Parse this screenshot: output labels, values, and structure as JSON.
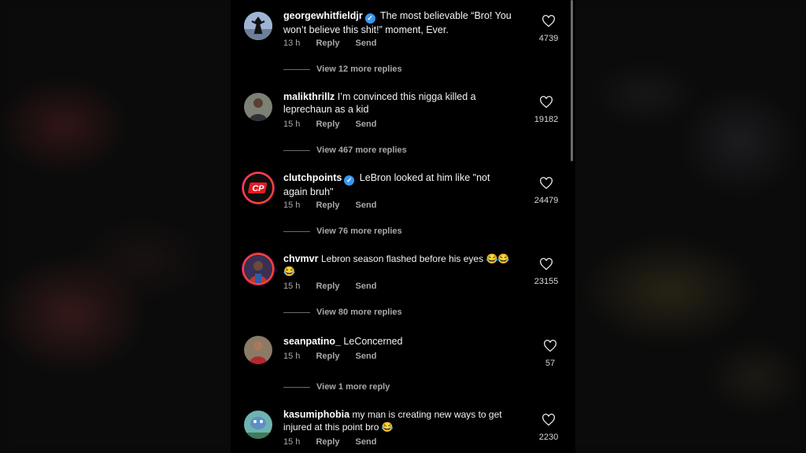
{
  "comments": [
    {
      "username": "georgewhitfieldjr",
      "verified": true,
      "text": "The most believable “Bro! You won’t believe this shit!” moment, Ever.",
      "time": "13 h",
      "reply_label": "Reply",
      "send_label": "Send",
      "likes": "4739",
      "replies": "View 12 more replies"
    },
    {
      "username": "malikthrillz",
      "verified": false,
      "text": "I’m convinced this nigga killed a leprechaun as a kid",
      "time": "15 h",
      "reply_label": "Reply",
      "send_label": "Send",
      "likes": "19182",
      "replies": "View 467 more replies"
    },
    {
      "username": "clutchpoints",
      "verified": true,
      "text": "LeBron looked at him like \"not again bruh\"",
      "time": "15 h",
      "reply_label": "Reply",
      "send_label": "Send",
      "likes": "24479",
      "replies": "View 76 more replies",
      "avatar_text": "CP"
    },
    {
      "username": "chvmvr",
      "verified": false,
      "text": "Lebron season flashed before his eyes 😂😂😂",
      "time": "15 h",
      "reply_label": "Reply",
      "send_label": "Send",
      "likes": "23155",
      "replies": "View 80 more replies"
    },
    {
      "username": "seanpatino_",
      "verified": false,
      "text": "LeConcerned",
      "time": "15 h",
      "reply_label": "Reply",
      "send_label": "Send",
      "likes": "57",
      "replies": "View 1 more reply"
    },
    {
      "username": "kasumiphobia",
      "verified": false,
      "text": "my man is creating new ways to get injured at this point bro 😂",
      "time": "15 h",
      "reply_label": "Reply",
      "send_label": "Send",
      "likes": "2230"
    }
  ],
  "colors": {
    "verified": "#3897f0",
    "clutchpoints_red": "#e21b23",
    "ring": "#ff4b2b"
  },
  "icons": {
    "like": "heart-outline-icon",
    "verified": "verified-badge-icon"
  }
}
